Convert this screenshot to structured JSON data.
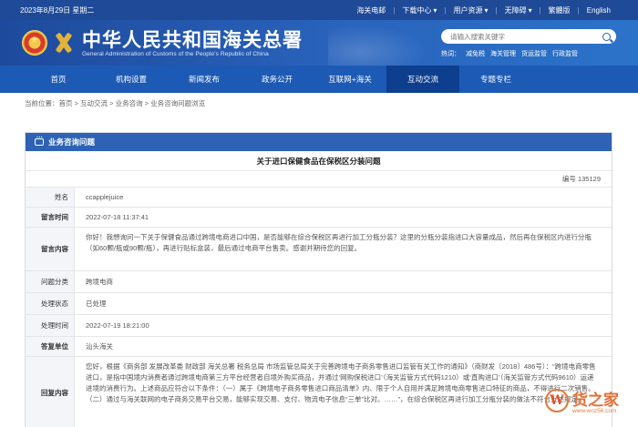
{
  "topbar": {
    "date": "2023年8月29日 星期二",
    "links": [
      {
        "label": "海关电邮",
        "caret": false
      },
      {
        "label": "下载中心",
        "caret": true
      },
      {
        "label": "用户资源",
        "caret": true
      },
      {
        "label": "无障碍",
        "caret": true
      },
      {
        "label": "繁體版",
        "caret": false
      },
      {
        "label": "English",
        "caret": false
      }
    ]
  },
  "header": {
    "title_cn": "中华人民共和国海关总署",
    "title_en": "General Administration of Customs of the People's Republic of China",
    "search_placeholder": "请输入搜索关键字",
    "hot_label": "热词：",
    "hot_words": [
      "减免税",
      "海关管理",
      "货运监管",
      "行政监管"
    ]
  },
  "nav": {
    "items": [
      "首页",
      "机构设置",
      "新闻发布",
      "政务公开",
      "互联网+海关",
      "互动交流",
      "专题专栏"
    ],
    "active_index": 5
  },
  "breadcrumb": "当前位置：首页 > 互动交流 > 业务咨询 > 业务咨询问题浏览",
  "panel": {
    "header": "业务咨询问题",
    "question_title": "关于进口保健食品在保税区分装问题",
    "id_label": "编号",
    "id_value": "135129",
    "rows": {
      "name_label": "姓名",
      "name_value": "ccapplejuice",
      "time_label": "留言时间",
      "time_value": "2022-07-18 11:37:41",
      "content_label": "留言内容",
      "content_value": "你好！我想询问一下关于保健食品通过跨境电商进口中国，是否能够在综合保税区再进行加工分瓶分装？这里的分瓶分装指进口大容量成品，然后再在保税区内进行分瓶（如60颗/瓶或90颗/瓶），再进行贴标盒装，最后通过电商平台售卖。感谢并期待您的回复。",
      "category_label": "问题分类",
      "category_value": "跨境电商",
      "status_label": "处理状态",
      "status_value": "已处理",
      "handle_time_label": "处理时间",
      "handle_time_value": "2022-07-19 18:21:00",
      "unit_label": "答复单位",
      "unit_value": "汕头海关",
      "reply_label": "回复内容",
      "reply_value": "您好，根据《商务部 发展改革委 财政部 海关总署 税务总局 市场监管总局关于完善跨境电子商务零售进口监管有关工作的通知》（商财发〔2018〕486号）：“跨境电商零售进口，是指中国境内消费者通过跨境电商第三方平台经营者自境外购买商品，并通过‘网购保税进口’（海关监管方式代码1210）或‘直购进口’（海关监管方式代码9610）运递进境的消费行为。上述商品应符合以下条件：（一）属于《跨境电子商务零售进口商品清单》内、限于个人自用并满足跨境电商零售进口特征的商品，不得进行二次销售。（二）通过与海关联网的电子商务交易平台交易，能够实现交易、支付、物流电子信息“三单”比对。……”，在综合保税区再进行加工分瓶分装的做法不符合上述规定。"
    }
  },
  "watermark": {
    "mark": "W",
    "text": "货之家",
    "url": "www.woz56.com"
  }
}
